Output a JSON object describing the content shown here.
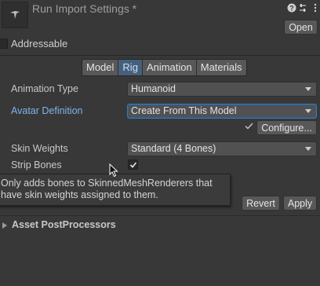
{
  "header": {
    "title": "Run Import Settings *",
    "icons": [
      "help-icon",
      "settings-icon",
      "more-icon"
    ],
    "open_label": "Open"
  },
  "addressable": {
    "label": "Addressable",
    "checked": false
  },
  "tabs": [
    {
      "label": "Model",
      "active": false
    },
    {
      "label": "Rig",
      "active": true
    },
    {
      "label": "Animation",
      "active": false
    },
    {
      "label": "Materials",
      "active": false
    }
  ],
  "rig": {
    "animation_type": {
      "label": "Animation Type",
      "value": "Humanoid"
    },
    "avatar_definition": {
      "label": "Avatar Definition",
      "value": "Create From This Model"
    },
    "configure_label": "Configure...",
    "skin_weights": {
      "label": "Skin Weights",
      "value": "Standard (4 Bones)"
    },
    "strip_bones": {
      "label": "Strip Bones",
      "checked": true
    }
  },
  "tooltip": {
    "line1": "Only adds bones to SkinnedMeshRenderers that",
    "line2": "have skin weights assigned to them."
  },
  "actions": {
    "revert_label": "Revert",
    "apply_label": "Apply"
  },
  "asset_postprocessors": {
    "label": "Asset PostProcessors",
    "expanded": false
  },
  "colors": {
    "background": "#383838",
    "accent": "#46607c",
    "link": "#7fb3ea",
    "focus": "#3a79bb"
  }
}
